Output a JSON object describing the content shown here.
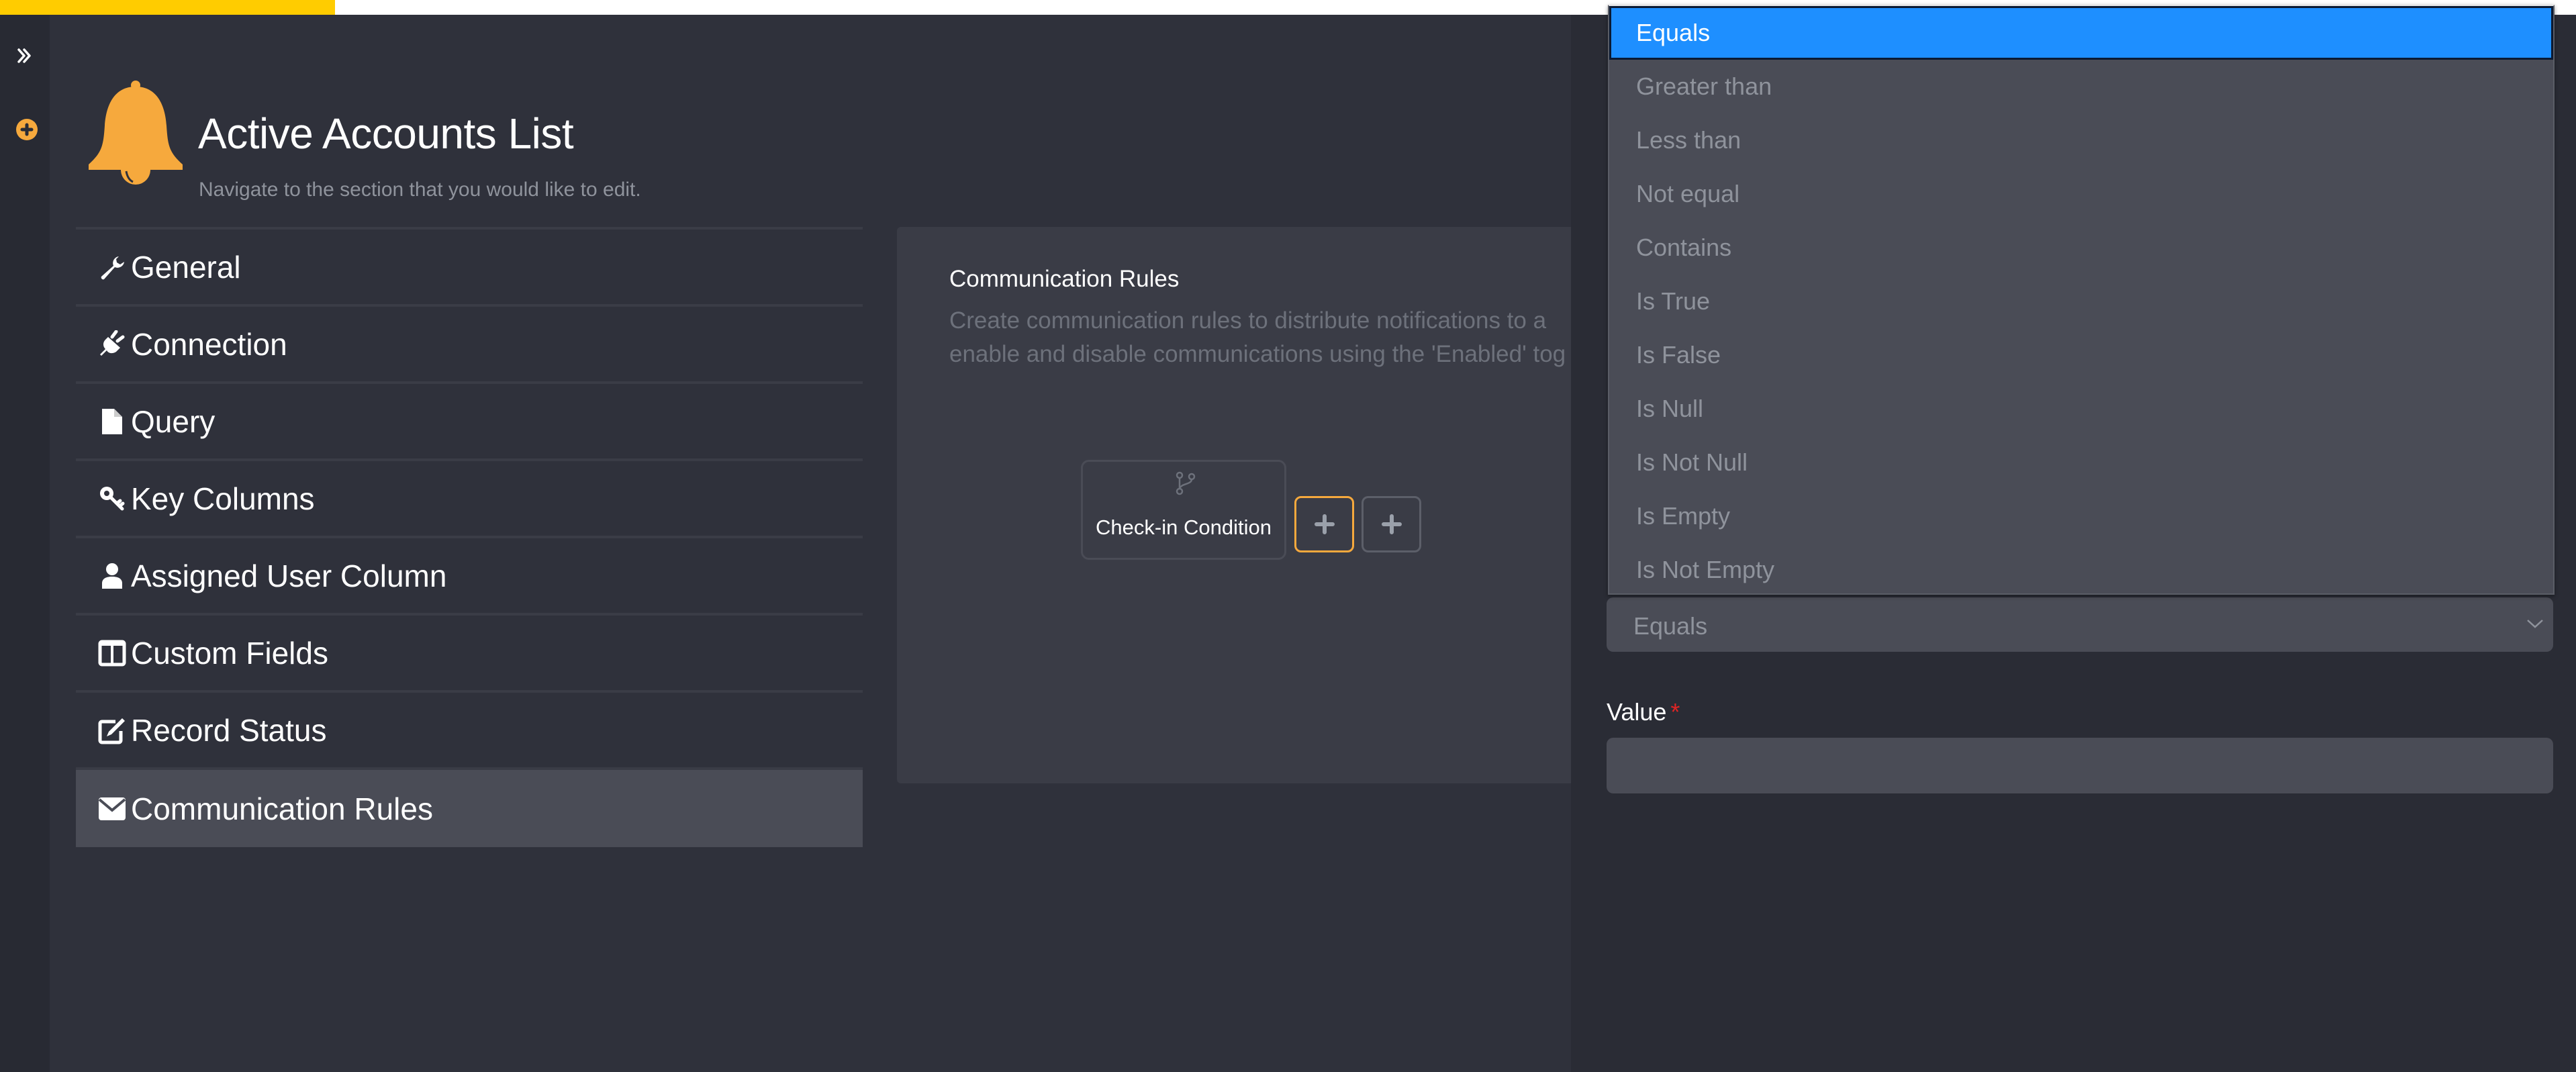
{
  "topbar": {
    "progress_percent": 13,
    "progress_color": "#ffcc00"
  },
  "rail": {
    "expand_icon": "double-chevron-right-icon",
    "add_icon": "plus-circle-icon"
  },
  "header": {
    "icon": "bell-icon",
    "title": "Active Accounts List",
    "subtitle": "Navigate to the section that you would like to edit."
  },
  "nav": {
    "items": [
      {
        "label": "General",
        "icon": "wrench-icon",
        "active": false
      },
      {
        "label": "Connection",
        "icon": "plug-icon",
        "active": false
      },
      {
        "label": "Query",
        "icon": "file-icon",
        "active": false
      },
      {
        "label": "Key Columns",
        "icon": "key-icon",
        "active": false
      },
      {
        "label": "Assigned User Column",
        "icon": "user-icon",
        "active": false
      },
      {
        "label": "Custom Fields",
        "icon": "columns-icon",
        "active": false
      },
      {
        "label": "Record Status",
        "icon": "edit-icon",
        "active": false
      },
      {
        "label": "Communication Rules",
        "icon": "envelope-icon",
        "active": true
      }
    ]
  },
  "panel": {
    "title": "Communication Rules",
    "description_line1": "Create communication rules to distribute notifications to a",
    "description_line2": "enable and disable communications using the 'Enabled' tog",
    "node": {
      "icon": "code-branch-icon",
      "label": "Check-in Condition"
    },
    "add_buttons": [
      {
        "icon": "plus-icon",
        "highlighted": true
      },
      {
        "icon": "plus-icon",
        "highlighted": false
      }
    ]
  },
  "condition_form": {
    "operator_select": {
      "selected": "Equals",
      "options": [
        "Equals",
        "Greater than",
        "Less than",
        "Not equal",
        "Contains",
        "Is True",
        "Is False",
        "Is Null",
        "Is Not Null",
        "Is Empty",
        "Is Not Empty"
      ],
      "expanded": true
    },
    "value_field": {
      "label": "Value",
      "required_marker": "*",
      "value": ""
    }
  },
  "colors": {
    "accent": "#f6a93d",
    "selected_option": "#1e8fff",
    "required": "#e02424"
  }
}
